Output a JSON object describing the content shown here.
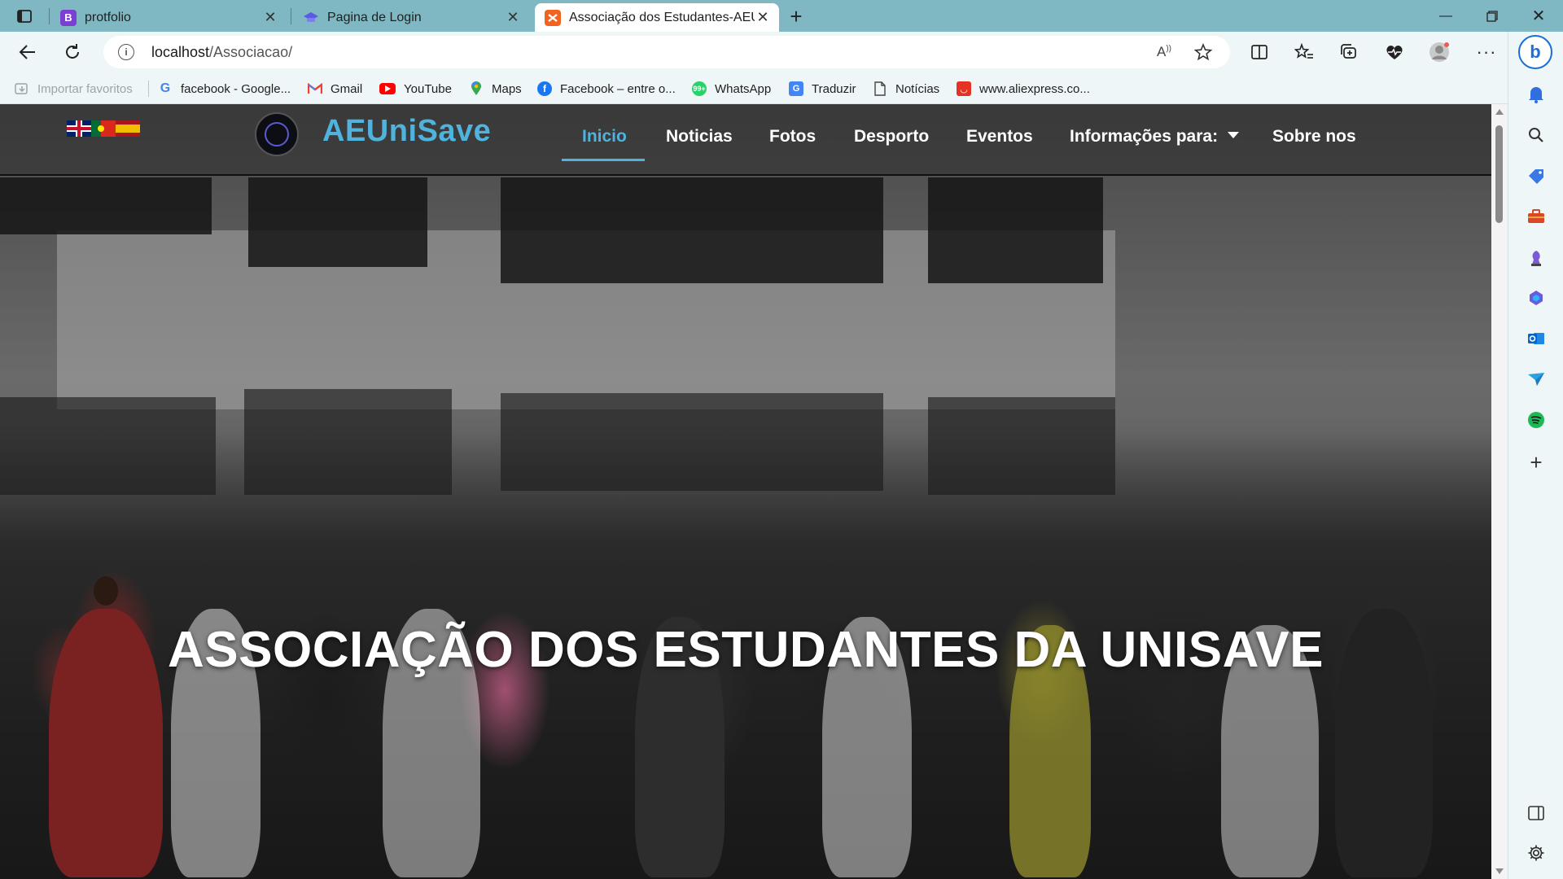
{
  "browser": {
    "tabs": [
      {
        "title": "protfolio",
        "favicon_letter": "B",
        "favicon_color": "#7b3fd1"
      },
      {
        "title": "Pagina de Login",
        "favicon_letter": "",
        "favicon_color": "#5a5ae6"
      },
      {
        "title": "Associação dos Estudantes-AEUnisave",
        "favicon_letter": "",
        "favicon_color": "#f26322"
      }
    ],
    "active_tab_index": 2,
    "url": {
      "host": "localhost",
      "path": "/Associacao/"
    },
    "favorites": [
      {
        "label": "Importar favoritos",
        "icon": "import-favorites-icon",
        "muted": true
      },
      {
        "label": "facebook - Google...",
        "icon": "google-icon"
      },
      {
        "label": "Gmail",
        "icon": "gmail-icon"
      },
      {
        "label": "YouTube",
        "icon": "youtube-icon"
      },
      {
        "label": "Maps",
        "icon": "maps-icon"
      },
      {
        "label": "Facebook – entre o...",
        "icon": "facebook-icon"
      },
      {
        "label": "WhatsApp",
        "icon": "whatsapp-icon"
      },
      {
        "label": "Traduzir",
        "icon": "translate-icon"
      },
      {
        "label": "Notícias",
        "icon": "document-icon"
      },
      {
        "label": "www.aliexpress.co...",
        "icon": "aliexpress-icon"
      }
    ]
  },
  "site": {
    "brand": "AEUniSave",
    "accent_color": "#4fb3de",
    "languages": [
      "English",
      "Português",
      "Español"
    ],
    "nav": [
      {
        "label": "Inicio",
        "active": true
      },
      {
        "label": "Noticias"
      },
      {
        "label": "Fotos"
      },
      {
        "label": "Desporto"
      },
      {
        "label": "Eventos"
      },
      {
        "label": "Informações para:",
        "dropdown": true
      },
      {
        "label": "Sobre nos"
      }
    ],
    "hero_title": "ASSOCIAÇÃO DOS ESTUDANTES DA UNISAVE"
  }
}
